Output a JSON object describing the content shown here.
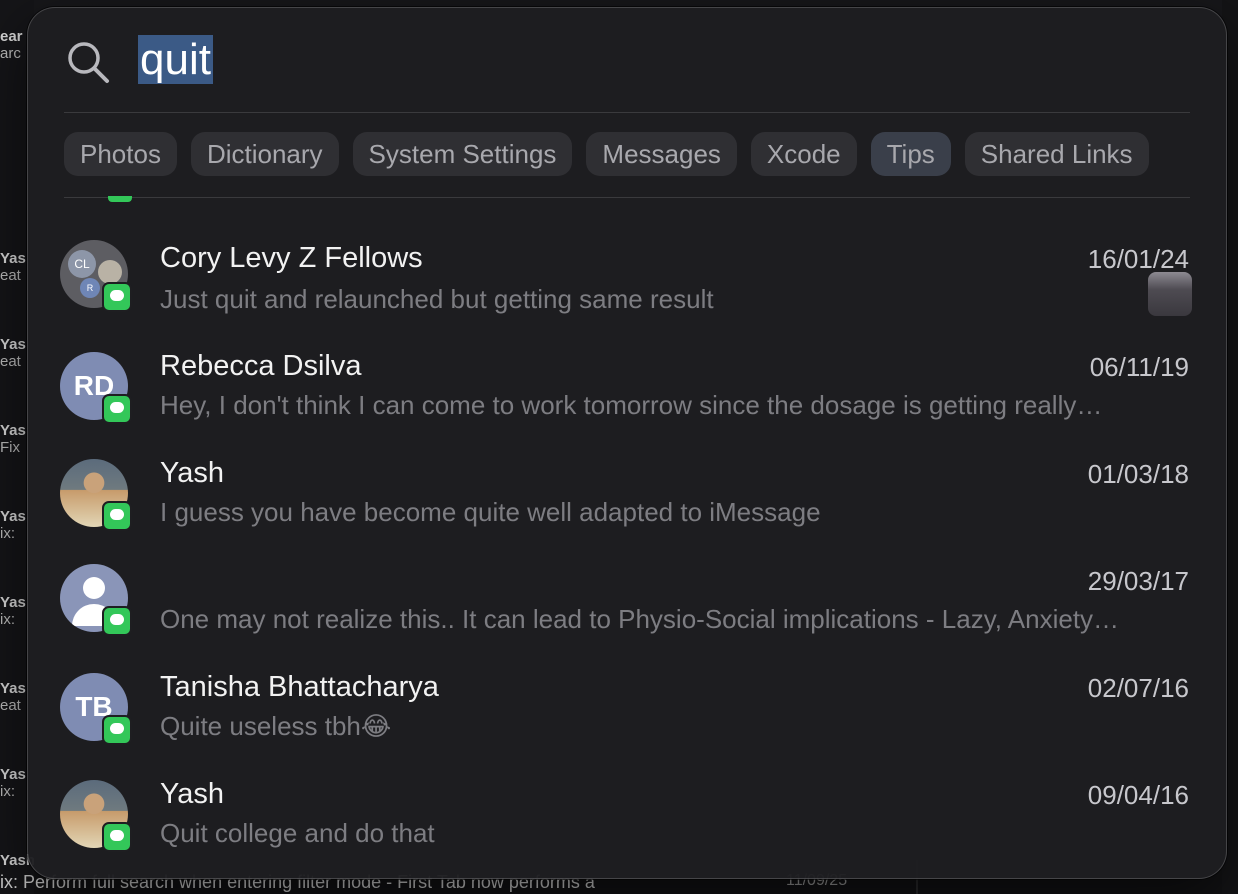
{
  "search": {
    "query": "quit"
  },
  "categories": [
    "Photos",
    "Dictionary",
    "System Settings",
    "Messages",
    "Xcode",
    "Tips",
    "Shared Links"
  ],
  "results": [
    {
      "name": "Cory Levy Z Fellows",
      "date": "16/01/24",
      "preview": "Just quit and relaunched but getting same result",
      "avatar": "group",
      "avatar_initials": [
        "CL",
        "R"
      ],
      "has_attachment": true
    },
    {
      "name": "Rebecca Dsilva",
      "date": "06/11/19",
      "preview": "Hey, I don't think I can come to work tomorrow since the dosage is getting really…",
      "avatar": "initials",
      "initials": "RD"
    },
    {
      "name": "Yash",
      "date": "01/03/18",
      "preview": "I guess you have become quite well adapted to iMessage",
      "avatar": "photo"
    },
    {
      "name": "",
      "date": "29/03/17",
      "preview": "One may not realize this.. It can lead to Physio-Social implications - Lazy, Anxiety…",
      "avatar": "person-icon"
    },
    {
      "name": "Tanisha Bhattacharya",
      "date": "02/07/16",
      "preview": "Quite useless tbh😂",
      "avatar": "initials",
      "initials": "TB"
    },
    {
      "name": "Yash",
      "date": "09/04/16",
      "preview": "Quit college and do that",
      "avatar": "photo"
    }
  ],
  "background": {
    "left_fragments": [
      {
        "bold": "ear",
        "sub": "arc"
      },
      {
        "bold": "Yas",
        "sub": "eat"
      },
      {
        "bold": "Yas",
        "sub": "eat"
      },
      {
        "bold": "Yas",
        "sub": "Fix"
      },
      {
        "bold": "Yas",
        "sub": "ix:"
      },
      {
        "bold": "Yas",
        "sub": "ix:"
      },
      {
        "bold": "Yas",
        "sub": "eat"
      },
      {
        "bold": "Yas",
        "sub": "ix:"
      },
      {
        "bold": "Yash",
        "sub": ""
      }
    ],
    "bottom_text": "ix: Perform full search when entering filter mode - First Tab now performs a",
    "bottom_date": "11/09/25"
  },
  "colors": {
    "accent_selection": "#3b5a86",
    "messages_badge": "#33c759",
    "avatar_initials_bg": "#7f8cb3"
  }
}
